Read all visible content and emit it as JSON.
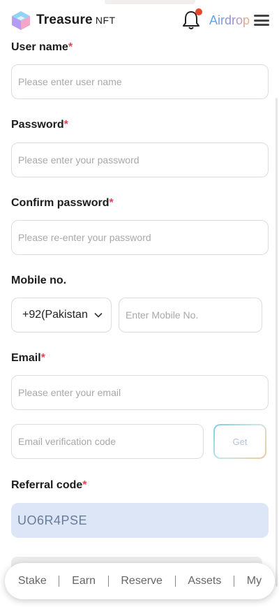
{
  "header": {
    "brand": "Treasure",
    "brand_sub": "NFT",
    "airdrop": "Airdrop",
    "notification_dot_color": "#e8452f"
  },
  "form": {
    "username": {
      "label": "User name",
      "required_mark": "*",
      "placeholder": "Please enter user name",
      "value": ""
    },
    "password": {
      "label": "Password",
      "required_mark": "*",
      "placeholder": "Please enter your password",
      "value": ""
    },
    "confirm_password": {
      "label": "Confirm password",
      "required_mark": "*",
      "placeholder": "Please re-enter your password",
      "value": ""
    },
    "mobile": {
      "label": "Mobile no.",
      "country": "+92(Pakistan",
      "placeholder": "Enter Mobile No.",
      "value": ""
    },
    "email": {
      "label": "Email",
      "required_mark": "*",
      "placeholder": "Please enter your email",
      "value": ""
    },
    "verification": {
      "placeholder": "Email verification code",
      "value": "",
      "get_label": "Get"
    },
    "referral": {
      "label": "Referral code",
      "required_mark": "*",
      "value": "UO6R4PSE"
    }
  },
  "bottom_nav": {
    "items": [
      "Stake",
      "Earn",
      "Reserve",
      "Assets",
      "My"
    ]
  },
  "icons": {
    "logo": "logo-cube-icon",
    "bell": "bell-icon",
    "menu": "hamburger-menu-icon",
    "dropdown": "chevron-down-icon"
  },
  "colors": {
    "required": "#e0454f",
    "referral_bg": "#dce6f6",
    "referral_text": "#6a7c98"
  }
}
